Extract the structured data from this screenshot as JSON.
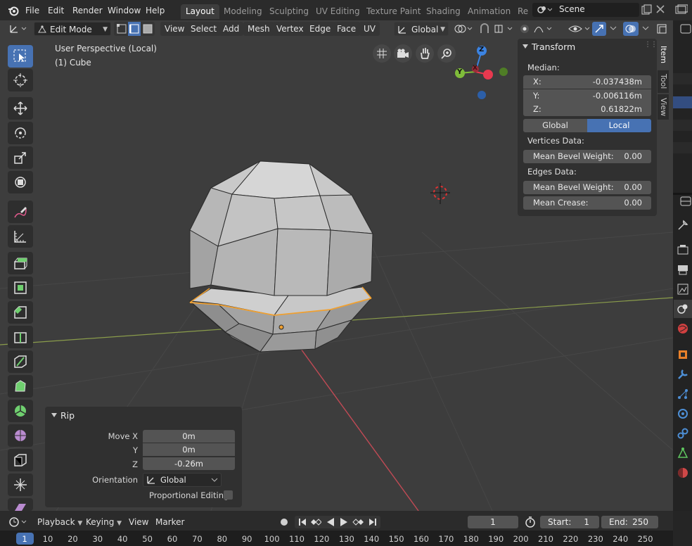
{
  "menus": [
    "File",
    "Edit",
    "Render",
    "Window",
    "Help"
  ],
  "workspace_tabs": [
    "Layout",
    "Modeling",
    "Sculpting",
    "UV Editing",
    "Texture Paint",
    "Shading",
    "Animation",
    "Re"
  ],
  "active_workspace": "Layout",
  "scene": {
    "name": "Scene"
  },
  "vp_header": {
    "mode": "Edit Mode",
    "menus": [
      "View",
      "Select",
      "Add",
      "Mesh",
      "Vertex",
      "Edge",
      "Face",
      "UV"
    ],
    "orientation": "Global"
  },
  "overlay_text": {
    "perspective": "User Perspective (Local)",
    "object": "(1) Cube"
  },
  "gizmo": {
    "z": "Z",
    "y": "Y",
    "x": "X"
  },
  "npanel": {
    "title": "Transform",
    "median_label": "Median:",
    "x": {
      "label": "X:",
      "value": "-0.037438m"
    },
    "y": {
      "label": "Y:",
      "value": "-0.006116m"
    },
    "z": {
      "label": "Z:",
      "value": "0.61822m"
    },
    "global": "Global",
    "local": "Local",
    "vertices_data": "Vertices Data:",
    "mean_bevel_v": {
      "label": "Mean Bevel Weight:",
      "value": "0.00"
    },
    "edges_data": "Edges Data:",
    "mean_bevel_e": {
      "label": "Mean Bevel Weight:",
      "value": "0.00"
    },
    "mean_crease": {
      "label": "Mean Crease:",
      "value": "0.00"
    }
  },
  "side_tabs": [
    "Item",
    "Tool",
    "View"
  ],
  "rip": {
    "title": "Rip",
    "move_x": {
      "label": "Move X",
      "value": "0m"
    },
    "y": {
      "label": "Y",
      "value": "0m"
    },
    "z": {
      "label": "Z",
      "value": "-0.26m"
    },
    "orientation": {
      "label": "Orientation",
      "value": "Global"
    },
    "proportional": {
      "label": "Proportional Editing",
      "checked": false
    }
  },
  "timeline": {
    "playback": "Playback",
    "keying": "Keying",
    "view": "View",
    "marker": "Marker",
    "current_frame": "1",
    "start_label": "Start:",
    "start": "1",
    "end_label": "End:",
    "end": "250",
    "ruler": [
      "1",
      "10",
      "20",
      "30",
      "40",
      "50",
      "60",
      "70",
      "80",
      "90",
      "100",
      "110",
      "120",
      "130",
      "140",
      "150",
      "160",
      "170",
      "180",
      "190",
      "200",
      "210",
      "220",
      "230",
      "240",
      "250"
    ]
  },
  "colors": {
    "accent": "#4772b3",
    "selected_edge": "#f0a030",
    "x_axis": "#e8394f",
    "y_axis": "#7fbc3a",
    "z_axis": "#3b83e2"
  }
}
